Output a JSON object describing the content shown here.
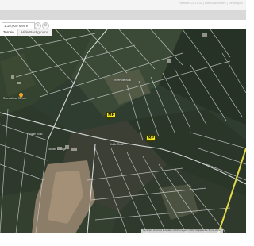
{
  "header": {
    "top_links": "Version 2017.32 | Release Notes | Developer"
  },
  "toolbar": {
    "zoom_value": "1:10,000 Metre",
    "refresh_icon": "refresh-icon",
    "settings_icon": "gear-icon"
  },
  "map_type": {
    "terrain_label": "Terrain",
    "hide_background_label": "Hide Background"
  },
  "markers": [
    {
      "label": "MP"
    },
    {
      "label": "MP"
    }
  ],
  "place_labels": {
    "school": "Recreational School",
    "road_west": "Biddle Road",
    "road_mid": "Biddle Road",
    "center_label": "Riverside Walk",
    "tip_label": "Tourism Cottage"
  },
  "attribution": {
    "text": "Keyboard shortcuts  Map data ©2017  Imagery ©2017 DigitalGlobe  Terms of Use"
  },
  "colors": {
    "marker_fill": "#f2ea1c",
    "highway": "#e4da4a",
    "field_lines": "#cfcfcf"
  }
}
